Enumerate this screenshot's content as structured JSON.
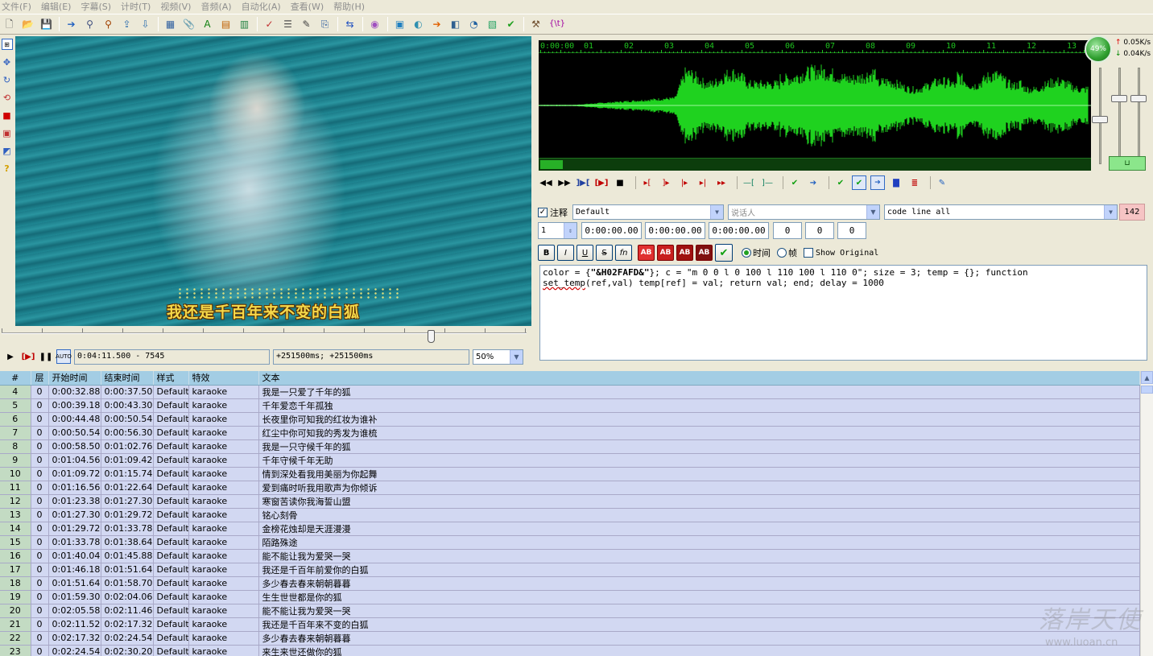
{
  "menu": [
    "文件(F)",
    "编辑(E)",
    "字幕(S)",
    "计时(T)",
    "视频(V)",
    "音频(A)",
    "自动化(A)",
    "查看(W)",
    "帮助(H)"
  ],
  "toolbar_icons": [
    "new-file-icon",
    "open-folder-icon",
    "save-icon",
    "jump-to-icon",
    "find-icon",
    "replace-icon",
    "import-icon",
    "export-icon",
    "style-manager-icon",
    "attachments-icon",
    "fonts-icon",
    "resample-icon",
    "spell-check-icon",
    "properties-icon",
    "notes-icon",
    "copy-icon",
    "translate-icon",
    "shift-times-icon",
    "timing-post-icon",
    "styling-assistant-icon",
    "kanji-timer-icon",
    "film-icon",
    "select-lines-icon",
    "automation-icon",
    "options-icon",
    "tools-icon",
    "lua-icon"
  ],
  "video": {
    "lyric": "我还是千百年来不变的白狐",
    "time_display": "0:04:11.500 - 7545",
    "offset_display": "+251500ms; +251500ms",
    "zoom": "50%"
  },
  "audio": {
    "timeline_labels": [
      "0:00:00",
      "01",
      "02",
      "03",
      "04",
      "05",
      "06",
      "07",
      "08",
      "09",
      "10",
      "11",
      "12",
      "13"
    ],
    "speed_percent": "49%",
    "upload_speed": "0.05K/s",
    "download_speed": "0.04K/s",
    "wave_color": "#1fd21f"
  },
  "edit": {
    "comment_label": "注释",
    "style": "Default",
    "actor_placeholder": "说话人",
    "effect": "code line all",
    "char_count": "142",
    "layer": "1",
    "start_time": "0:00:00.00",
    "end_time": "0:00:00.00",
    "duration": "0:00:00.00",
    "margin_l": "0",
    "margin_r": "0",
    "margin_v": "0",
    "bold": "B",
    "italic": "I",
    "underline": "U",
    "strike": "S",
    "fn": "fn",
    "ab_label": "AB",
    "time_label": "时间",
    "frame_label": "帧",
    "show_original_label": "Show Original",
    "code_line1_pre": "color = {",
    "code_line1_bold": "\"&H02FAFD&\"",
    "code_line1_post": "}; c = \"m 0 0 l 0 100 l 110 100 l 110 0\"; size = 3; temp = {}; function",
    "code_line2_red": "set_temp",
    "code_line2_rest": "(ref,val) temp[ref] = val; return val; end; delay  = 1000"
  },
  "grid": {
    "headers": [
      "#",
      "层",
      "开始时间",
      "结束时间",
      "样式",
      "特效",
      "文本"
    ],
    "rows": [
      [
        "4",
        "0",
        "0:00:32.88",
        "0:00:37.50",
        "Default",
        "karaoke",
        "我是一只爱了千年的狐"
      ],
      [
        "5",
        "0",
        "0:00:39.18",
        "0:00:43.30",
        "Default",
        "karaoke",
        "千年爱恋千年孤独"
      ],
      [
        "6",
        "0",
        "0:00:44.48",
        "0:00:50.54",
        "Default",
        "karaoke",
        "长夜里你可知我的红妆为谁补"
      ],
      [
        "7",
        "0",
        "0:00:50.54",
        "0:00:56.30",
        "Default",
        "karaoke",
        "红尘中你可知我的秀发为谁梳"
      ],
      [
        "8",
        "0",
        "0:00:58.50",
        "0:01:02.76",
        "Default",
        "karaoke",
        "我是一只守候千年的狐"
      ],
      [
        "9",
        "0",
        "0:01:04.56",
        "0:01:09.42",
        "Default",
        "karaoke",
        "千年守候千年无助"
      ],
      [
        "10",
        "0",
        "0:01:09.72",
        "0:01:15.74",
        "Default",
        "karaoke",
        "情到深处看我用美丽为你起舞"
      ],
      [
        "11",
        "0",
        "0:01:16.56",
        "0:01:22.64",
        "Default",
        "karaoke",
        "爱到痛时听我用歌声为你倾诉"
      ],
      [
        "12",
        "0",
        "0:01:23.38",
        "0:01:27.30",
        "Default",
        "karaoke",
        "寒窗苦读你我海誓山盟"
      ],
      [
        "13",
        "0",
        "0:01:27.30",
        "0:01:29.72",
        "Default",
        "karaoke",
        "铭心刻骨"
      ],
      [
        "14",
        "0",
        "0:01:29.72",
        "0:01:33.78",
        "Default",
        "karaoke",
        "金榜花烛却是天涯漫漫"
      ],
      [
        "15",
        "0",
        "0:01:33.78",
        "0:01:38.64",
        "Default",
        "karaoke",
        "陌路殊途"
      ],
      [
        "16",
        "0",
        "0:01:40.04",
        "0:01:45.88",
        "Default",
        "karaoke",
        "能不能让我为爱哭一哭"
      ],
      [
        "17",
        "0",
        "0:01:46.18",
        "0:01:51.64",
        "Default",
        "karaoke",
        "我还是千百年前爱你的白狐"
      ],
      [
        "18",
        "0",
        "0:01:51.64",
        "0:01:58.70",
        "Default",
        "karaoke",
        "多少春去春来朝朝暮暮"
      ],
      [
        "19",
        "0",
        "0:01:59.30",
        "0:02:04.06",
        "Default",
        "karaoke",
        "生生世世都是你的狐"
      ],
      [
        "20",
        "0",
        "0:02:05.58",
        "0:02:11.46",
        "Default",
        "karaoke",
        "能不能让我为爱哭一哭"
      ],
      [
        "21",
        "0",
        "0:02:11.52",
        "0:02:17.32",
        "Default",
        "karaoke",
        "我还是千百年来不变的白狐"
      ],
      [
        "22",
        "0",
        "0:02:17.32",
        "0:02:24.54",
        "Default",
        "karaoke",
        "多少春去春来朝朝暮暮"
      ],
      [
        "23",
        "0",
        "0:02:24.54",
        "0:02:30.20",
        "Default",
        "karaoke",
        "来生来世还做你的狐"
      ]
    ]
  },
  "watermark": {
    "brush_text": "落岸天使",
    "url": "www.luoan.cn"
  }
}
